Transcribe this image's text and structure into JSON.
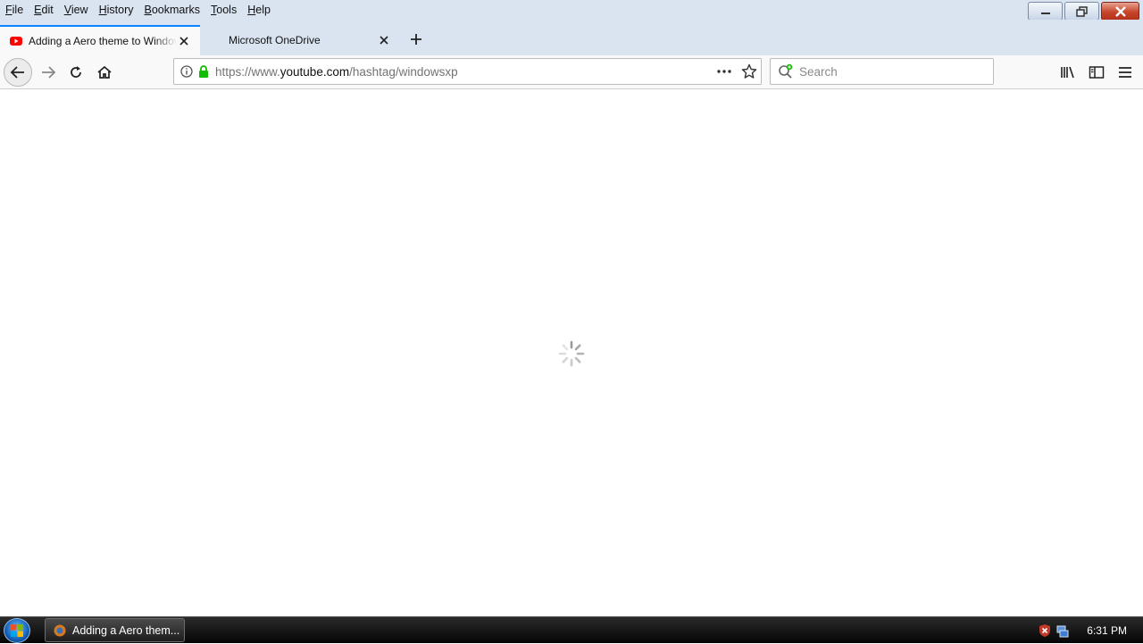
{
  "menubar": {
    "items": [
      "File",
      "Edit",
      "View",
      "History",
      "Bookmarks",
      "Tools",
      "Help"
    ]
  },
  "tabs": [
    {
      "label": "Adding a Aero theme to Windows XP",
      "icon": "youtube-icon",
      "active": true
    },
    {
      "label": "Microsoft OneDrive",
      "icon": "",
      "active": false
    }
  ],
  "navbar": {
    "url_prefix": "https://www.",
    "url_host": "youtube.com",
    "url_path": "/hashtag/windowsxp",
    "search_placeholder": "Search"
  },
  "content": {
    "state": "loading"
  },
  "taskbar": {
    "task_label": "Adding a Aero them...",
    "clock": "6:31 PM"
  },
  "colors": {
    "accent": "#0a84ff",
    "chrome_bg": "#dae4f1",
    "toolbar_bg": "#f9f9fa",
    "youtube_red": "#ff0000",
    "secure_green": "#12bc00"
  }
}
